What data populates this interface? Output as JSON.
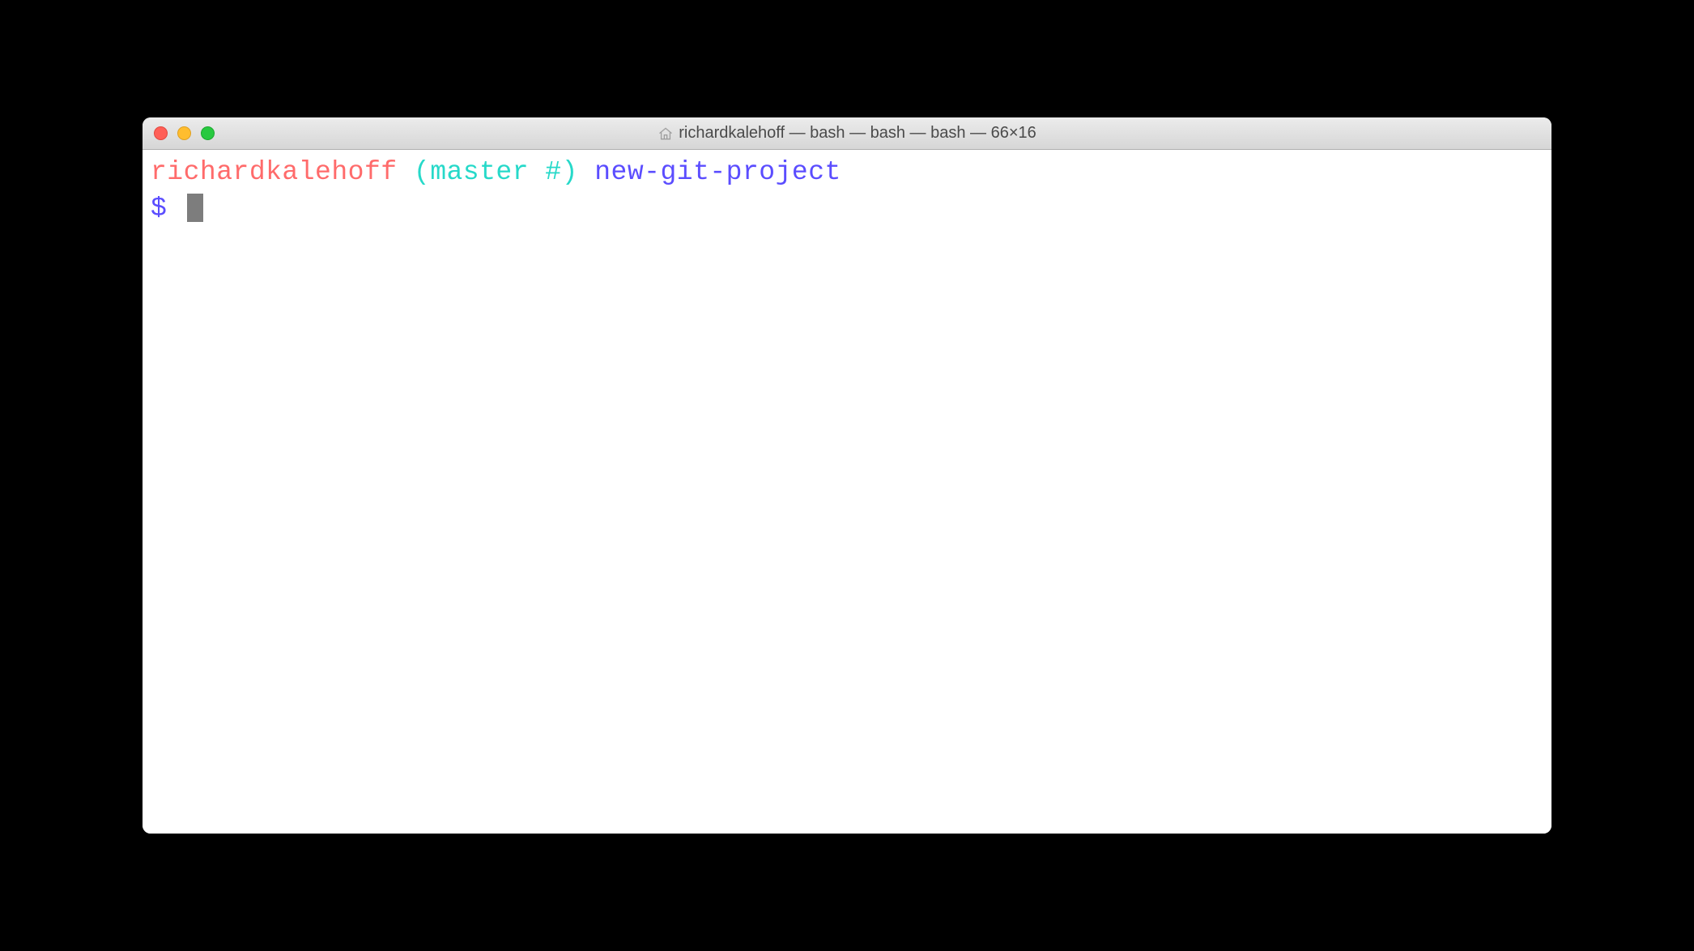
{
  "titlebar": {
    "title": "richardkalehoff — bash — bash — bash — 66×16"
  },
  "prompt": {
    "user": "richardkalehoff",
    "branch_open": "(",
    "branch_name": "master #",
    "branch_close": ")",
    "path": "new-git-project",
    "symbol": "$"
  }
}
